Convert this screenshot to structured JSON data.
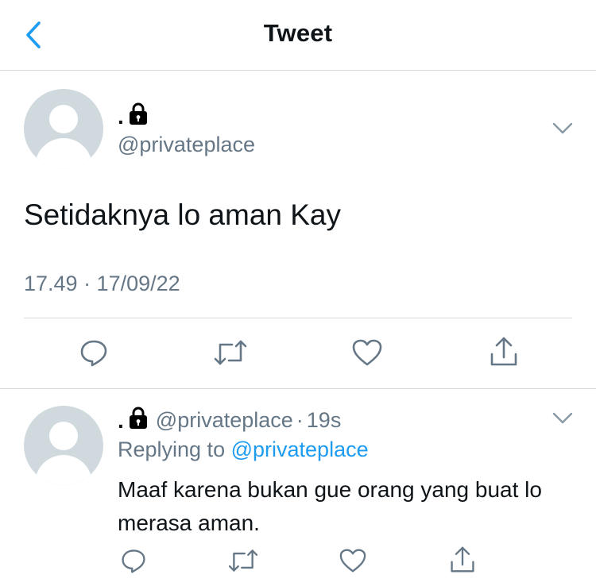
{
  "header": {
    "title": "Tweet",
    "back_icon": "chevron-left-icon",
    "accent_color": "#1d9bf0"
  },
  "tweet": {
    "display_name": ".",
    "locked": true,
    "handle": "@privateplace",
    "text": "Setidaknya lo aman Kay",
    "timestamp": "17.49 · 17/09/22",
    "actions": [
      "reply-icon",
      "retweet-icon",
      "like-icon",
      "share-icon"
    ]
  },
  "reply": {
    "display_name": ".",
    "locked": true,
    "handle": "@privateplace",
    "separator": "·",
    "age": "19s",
    "replying_prefix": "Replying to",
    "replying_to": "@privateplace",
    "text": "Maaf karena bukan gue orang yang buat lo merasa aman.",
    "actions": [
      "reply-icon",
      "retweet-icon",
      "like-icon",
      "share-icon"
    ]
  }
}
